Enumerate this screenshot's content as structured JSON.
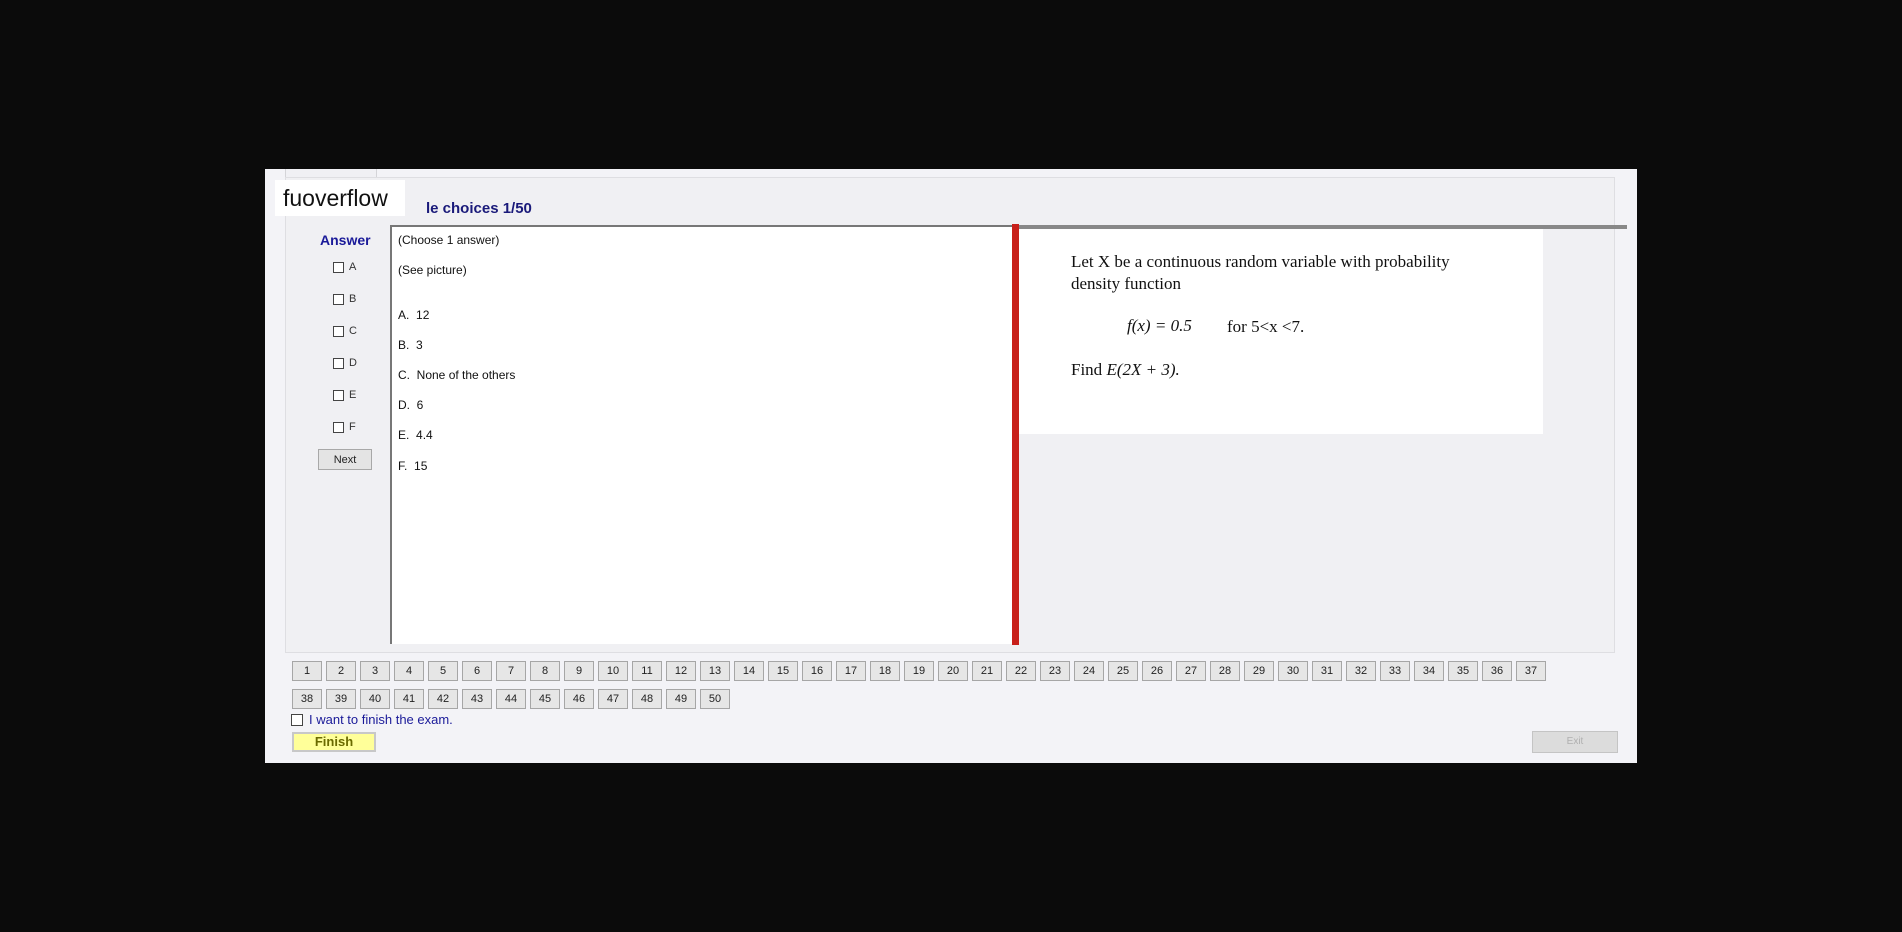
{
  "watermark": "fuoverflow",
  "header": {
    "title_visible": "le choices 1/50"
  },
  "answer": {
    "label": "Answer",
    "options": [
      "A",
      "B",
      "C",
      "D",
      "E",
      "F"
    ],
    "next_label": "Next"
  },
  "question": {
    "instruction": "(Choose 1 answer)",
    "note": "(See picture)",
    "choices": [
      {
        "letter": "A.",
        "text": "12"
      },
      {
        "letter": "B.",
        "text": "3"
      },
      {
        "letter": "C.",
        "text": "None of the others"
      },
      {
        "letter": "D.",
        "text": "6"
      },
      {
        "letter": "E.",
        "text": "4.4"
      },
      {
        "letter": "F.",
        "text": "15"
      }
    ]
  },
  "picture": {
    "line1": "Let X be a continuous random variable with probability",
    "line2": "density function",
    "formula": "f(x) = 0.5",
    "condition": "for 5<x <7.",
    "find_prefix": "Find",
    "find_expr": "E(2X + 3)."
  },
  "navigation": {
    "numbers": [
      "1",
      "2",
      "3",
      "4",
      "5",
      "6",
      "7",
      "8",
      "9",
      "10",
      "11",
      "12",
      "13",
      "14",
      "15",
      "16",
      "17",
      "18",
      "19",
      "20",
      "21",
      "22",
      "23",
      "24",
      "25",
      "26",
      "27",
      "28",
      "29",
      "30",
      "31",
      "32",
      "33",
      "34",
      "35",
      "36",
      "37",
      "38",
      "39",
      "40",
      "41",
      "42",
      "43",
      "44",
      "45",
      "46",
      "47",
      "48",
      "49",
      "50"
    ]
  },
  "finish": {
    "checkbox_label": "I want to finish the exam.",
    "finish_label": "Finish",
    "exit_label": "Exit"
  },
  "colors": {
    "divider": "#c8201a",
    "finish_bg": "#ffff99",
    "title": "#1a1a7a"
  }
}
